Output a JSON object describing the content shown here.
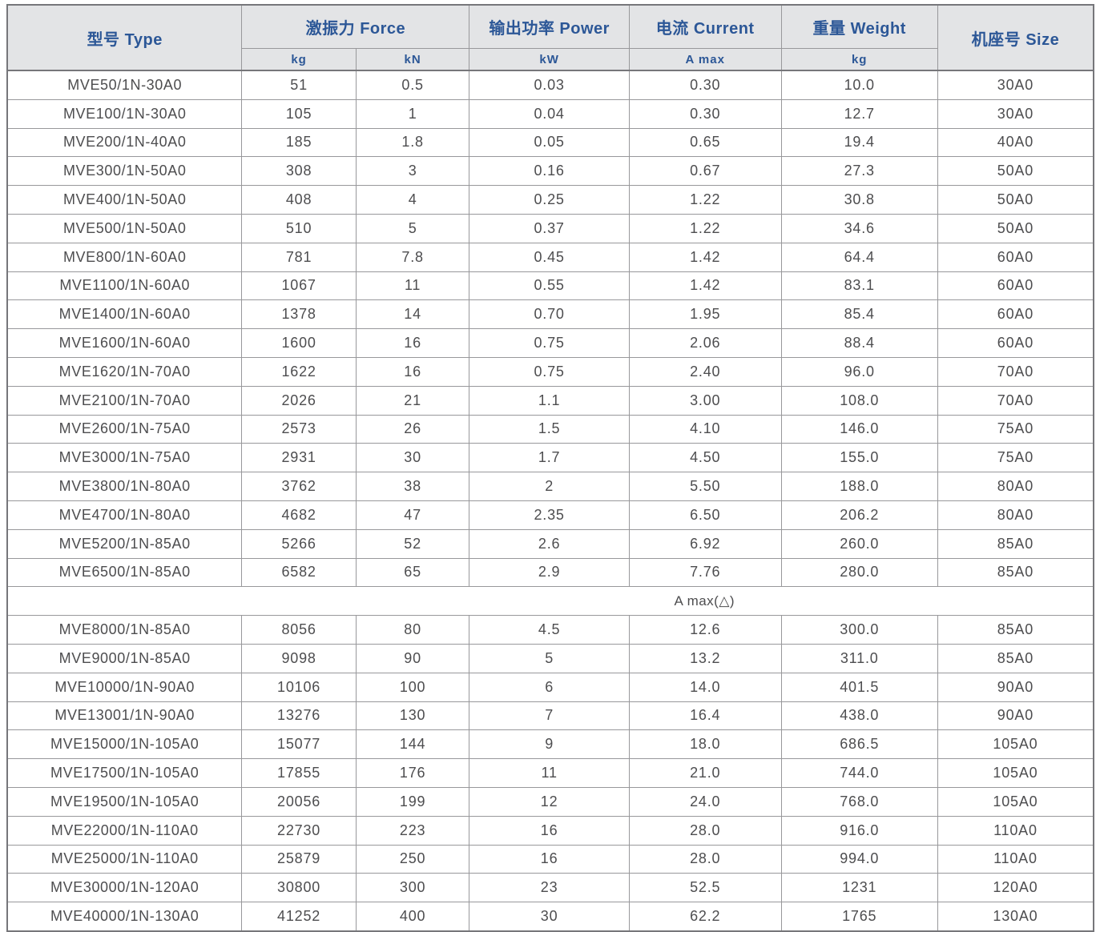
{
  "table": {
    "header": {
      "type": "型号 Type",
      "force": "激振力 Force",
      "power": "输出功率 Power",
      "current": "电流 Current",
      "weight": "重量 Weight",
      "size": "机座号 Size",
      "sub": {
        "force_kg": "kg",
        "force_kn": "kN",
        "power_kw": "kW",
        "current_amax": "A max",
        "weight_kg": "kg"
      }
    },
    "columns_order": [
      "type",
      "force_kg",
      "force_kn",
      "power_kw",
      "current_amax",
      "weight_kg",
      "size"
    ],
    "divider_label": "A max(△)",
    "rows_before_divider": [
      [
        "MVE50/1N-30A0",
        "51",
        "0.5",
        "0.03",
        "0.30",
        "10.0",
        "30A0"
      ],
      [
        "MVE100/1N-30A0",
        "105",
        "1",
        "0.04",
        "0.30",
        "12.7",
        "30A0"
      ],
      [
        "MVE200/1N-40A0",
        "185",
        "1.8",
        "0.05",
        "0.65",
        "19.4",
        "40A0"
      ],
      [
        "MVE300/1N-50A0",
        "308",
        "3",
        "0.16",
        "0.67",
        "27.3",
        "50A0"
      ],
      [
        "MVE400/1N-50A0",
        "408",
        "4",
        "0.25",
        "1.22",
        "30.8",
        "50A0"
      ],
      [
        "MVE500/1N-50A0",
        "510",
        "5",
        "0.37",
        "1.22",
        "34.6",
        "50A0"
      ],
      [
        "MVE800/1N-60A0",
        "781",
        "7.8",
        "0.45",
        "1.42",
        "64.4",
        "60A0"
      ],
      [
        "MVE1100/1N-60A0",
        "1067",
        "11",
        "0.55",
        "1.42",
        "83.1",
        "60A0"
      ],
      [
        "MVE1400/1N-60A0",
        "1378",
        "14",
        "0.70",
        "1.95",
        "85.4",
        "60A0"
      ],
      [
        "MVE1600/1N-60A0",
        "1600",
        "16",
        "0.75",
        "2.06",
        "88.4",
        "60A0"
      ],
      [
        "MVE1620/1N-70A0",
        "1622",
        "16",
        "0.75",
        "2.40",
        "96.0",
        "70A0"
      ],
      [
        "MVE2100/1N-70A0",
        "2026",
        "21",
        "1.1",
        "3.00",
        "108.0",
        "70A0"
      ],
      [
        "MVE2600/1N-75A0",
        "2573",
        "26",
        "1.5",
        "4.10",
        "146.0",
        "75A0"
      ],
      [
        "MVE3000/1N-75A0",
        "2931",
        "30",
        "1.7",
        "4.50",
        "155.0",
        "75A0"
      ],
      [
        "MVE3800/1N-80A0",
        "3762",
        "38",
        "2",
        "5.50",
        "188.0",
        "80A0"
      ],
      [
        "MVE4700/1N-80A0",
        "4682",
        "47",
        "2.35",
        "6.50",
        "206.2",
        "80A0"
      ],
      [
        "MVE5200/1N-85A0",
        "5266",
        "52",
        "2.6",
        "6.92",
        "260.0",
        "85A0"
      ],
      [
        "MVE6500/1N-85A0",
        "6582",
        "65",
        "2.9",
        "7.76",
        "280.0",
        "85A0"
      ]
    ],
    "rows_after_divider": [
      [
        "MVE8000/1N-85A0",
        "8056",
        "80",
        "4.5",
        "12.6",
        "300.0",
        "85A0"
      ],
      [
        "MVE9000/1N-85A0",
        "9098",
        "90",
        "5",
        "13.2",
        "311.0",
        "85A0"
      ],
      [
        "MVE10000/1N-90A0",
        "10106",
        "100",
        "6",
        "14.0",
        "401.5",
        "90A0"
      ],
      [
        "MVE13001/1N-90A0",
        "13276",
        "130",
        "7",
        "16.4",
        "438.0",
        "90A0"
      ],
      [
        "MVE15000/1N-105A0",
        "15077",
        "144",
        "9",
        "18.0",
        "686.5",
        "105A0"
      ],
      [
        "MVE17500/1N-105A0",
        "17855",
        "176",
        "11",
        "21.0",
        "744.0",
        "105A0"
      ],
      [
        "MVE19500/1N-105A0",
        "20056",
        "199",
        "12",
        "24.0",
        "768.0",
        "105A0"
      ],
      [
        "MVE22000/1N-110A0",
        "22730",
        "223",
        "16",
        "28.0",
        "916.0",
        "110A0"
      ],
      [
        "MVE25000/1N-110A0",
        "25879",
        "250",
        "16",
        "28.0",
        "994.0",
        "110A0"
      ],
      [
        "MVE30000/1N-120A0",
        "30800",
        "300",
        "23",
        "52.5",
        "1231",
        "120A0"
      ],
      [
        "MVE40000/1N-130A0",
        "41252",
        "400",
        "30",
        "62.2",
        "1765",
        "130A0"
      ]
    ]
  },
  "colors": {
    "header_bg": "#e3e4e6",
    "header_text": "#2c5797",
    "body_text": "#4d4d4f",
    "inner_border": "#98989b",
    "outer_border": "#76767a"
  }
}
